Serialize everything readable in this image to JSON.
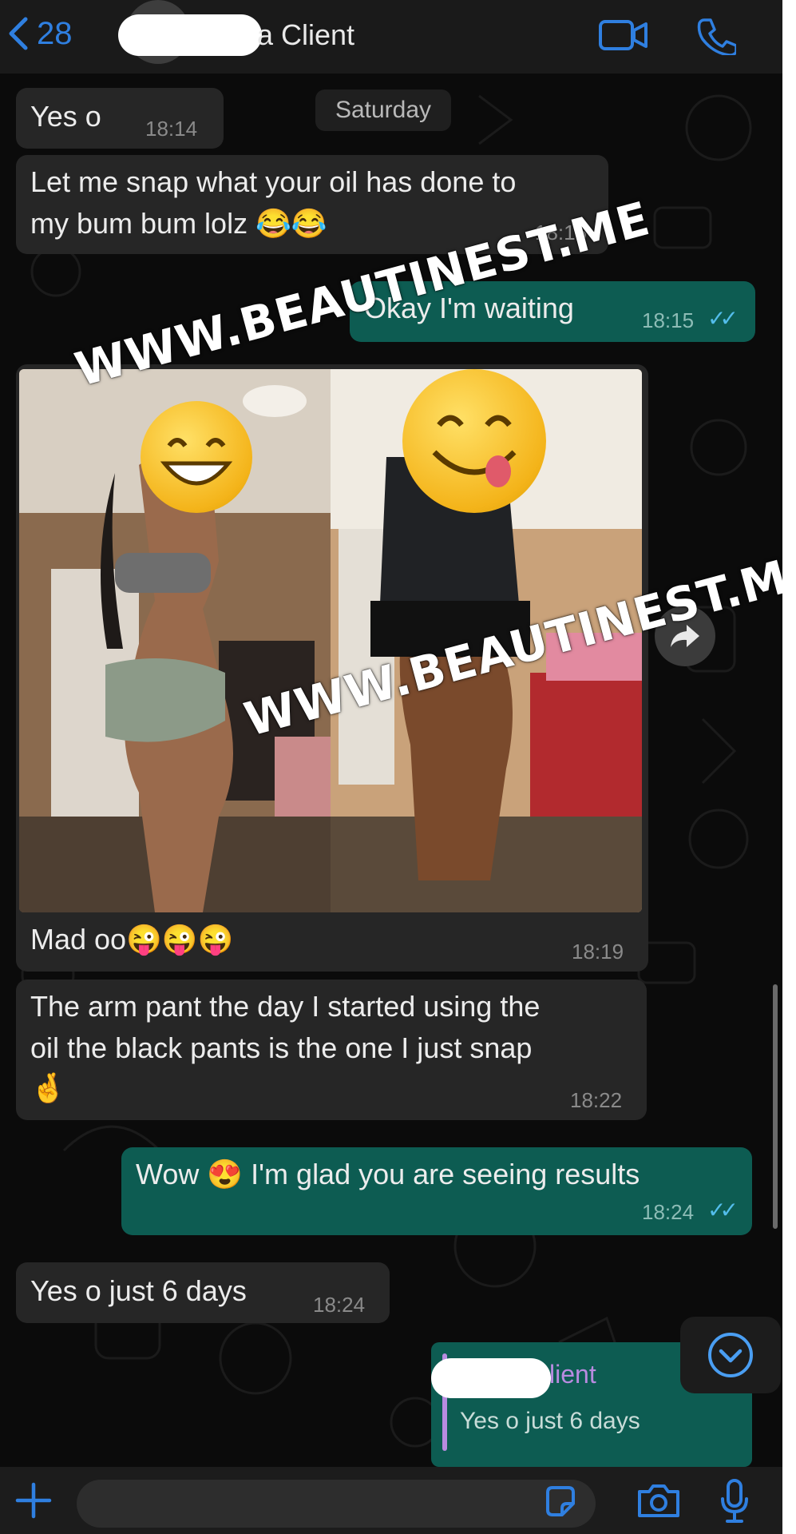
{
  "header": {
    "back_count": "28",
    "contact_name": "a Client"
  },
  "day_divider": "Saturday",
  "messages": [
    {
      "dir": "in",
      "text": "Yes o",
      "time": "18:14"
    },
    {
      "dir": "in",
      "text_line1": "Let me snap what your oil has done to",
      "text_line2": "my bum bum lolz 😂😂",
      "time": "18:15"
    },
    {
      "dir": "out",
      "text": "Okay I'm waiting",
      "time": "18:15"
    },
    {
      "dir": "in",
      "caption": "Mad oo😜😜😜",
      "time": "18:19"
    },
    {
      "dir": "in",
      "text_line1": "The arm pant the day I started using the",
      "text_line2": "oil the black pants is the one I just snap",
      "text_line3": "🤞",
      "time": "18:22"
    },
    {
      "dir": "out",
      "text": "Wow 😍 I'm glad you are seeing results",
      "time": "18:24"
    },
    {
      "dir": "in",
      "text": "Yes o just 6 days",
      "time": "18:24"
    }
  ],
  "reply_preview": {
    "author": "lient",
    "quoted": "Yes o just 6 days"
  },
  "watermark": "WWW.BEAUTINEST.ME",
  "colors": {
    "background": "#0b0b0b",
    "incoming_bubble": "#262626",
    "outgoing_bubble": "#0d5c52",
    "accent_blue": "#2f7fe0",
    "read_ticks": "#53bdeb"
  },
  "icons": [
    "chevron-left-icon",
    "video-call-icon",
    "phone-icon",
    "forward-icon",
    "scroll-down-icon",
    "plus-icon",
    "sticker-icon",
    "camera-icon",
    "microphone-icon"
  ]
}
